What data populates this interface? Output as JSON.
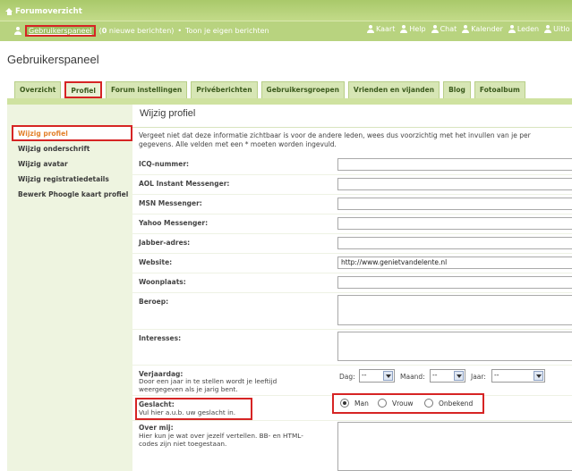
{
  "header": {
    "forum_overview": "Forumoverzicht",
    "control_panel_link": "Gebruikerspaneel",
    "new_messages_pre": "(",
    "new_messages_count": "0",
    "new_messages_text": " nieuwe berichten)",
    "bullet": "•",
    "own_posts": "Toon je eigen berichten",
    "right_links": [
      "Kaart",
      "Help",
      "Chat",
      "Kalender",
      "Leden",
      "Uitlo"
    ]
  },
  "page_title": "Gebruikerspaneel",
  "tabs": [
    "Overzicht",
    "Profiel",
    "Forum instellingen",
    "Privéberichten",
    "Gebruikersgroepen",
    "Vrienden en vijanden",
    "Blog",
    "Fotoalbum"
  ],
  "sidebar": [
    "Wijzig profiel",
    "Wijzig onderschrift",
    "Wijzig avatar",
    "Wijzig registratiedetails",
    "Bewerk Phoogle kaart profiel"
  ],
  "form": {
    "title": "Wijzig profiel",
    "intro_line1": "Vergeet niet dat deze informatie zichtbaar is voor de andere leden, wees dus voorzichtig met het invullen van je per",
    "intro_line2": "gegevens. Alle velden met een * moeten worden ingevuld.",
    "fields": {
      "icq": "ICQ-nummer:",
      "aol": "AOL Instant Messenger:",
      "msn": "MSN Messenger:",
      "yahoo": "Yahoo Messenger:",
      "jabber": "Jabber-adres:",
      "website": "Website:",
      "location": "Woonplaats:",
      "occupation": "Beroep:",
      "interests": "Interesses:"
    },
    "website_value": "http://www.genietvandelente.nl",
    "birthday": {
      "label": "Verjaardag:",
      "help_line1": "Door een jaar in te stellen wordt je leeftijd",
      "help_line2": "weergegeven als je jarig bent.",
      "day_label": "Dag:",
      "month_label": "Maand:",
      "year_label": "Jaar:",
      "day_value": "--",
      "month_value": "--",
      "year_value": "--"
    },
    "gender": {
      "label": "Geslacht:",
      "help": "Vul hier a.u.b. uw geslacht in.",
      "options": [
        "Man",
        "Vrouw",
        "Onbekend"
      ],
      "selected": "Man"
    },
    "about": {
      "label": "Over mij:",
      "help_line1": "Hier kun je wat over jezelf vertellen. BB- en HTML-",
      "help_line2": "codes zijn niet toegestaan."
    }
  }
}
